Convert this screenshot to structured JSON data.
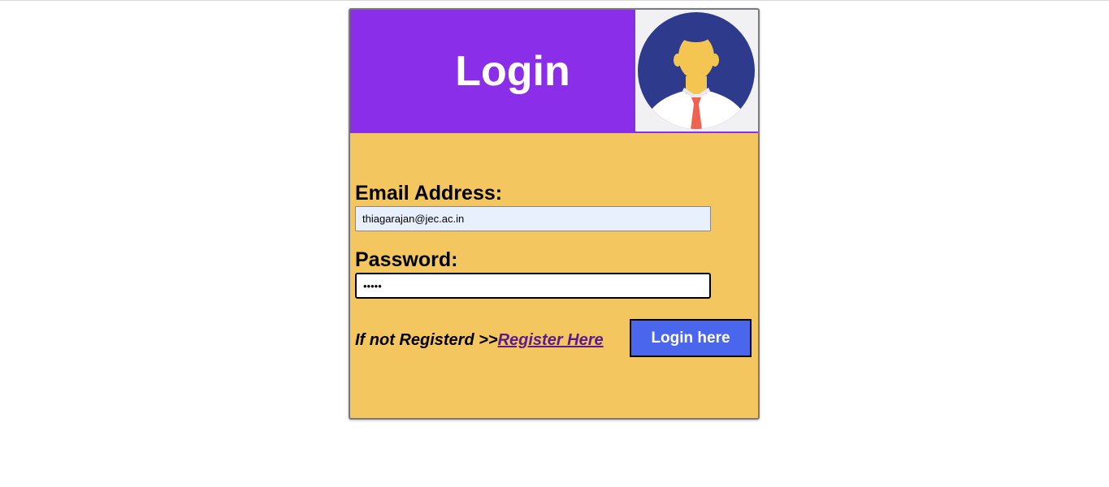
{
  "header": {
    "title": "Login"
  },
  "form": {
    "email_label": "Email Address:",
    "email_value": "thiagarajan@jec.ac.in",
    "password_label": "Password:",
    "password_value": "•••••",
    "register_prompt": "If not Registerd >>",
    "register_link": "Register Here",
    "login_button": "Login here"
  },
  "icons": {
    "avatar": "user-avatar-icon"
  },
  "colors": {
    "header_bg": "#8a2eea",
    "card_bg": "#f4c660",
    "button_bg": "#4a66ec",
    "avatar_circle": "#2e3a8c",
    "email_input_bg": "#e8f0fe",
    "link_color": "#5b1a8e"
  }
}
